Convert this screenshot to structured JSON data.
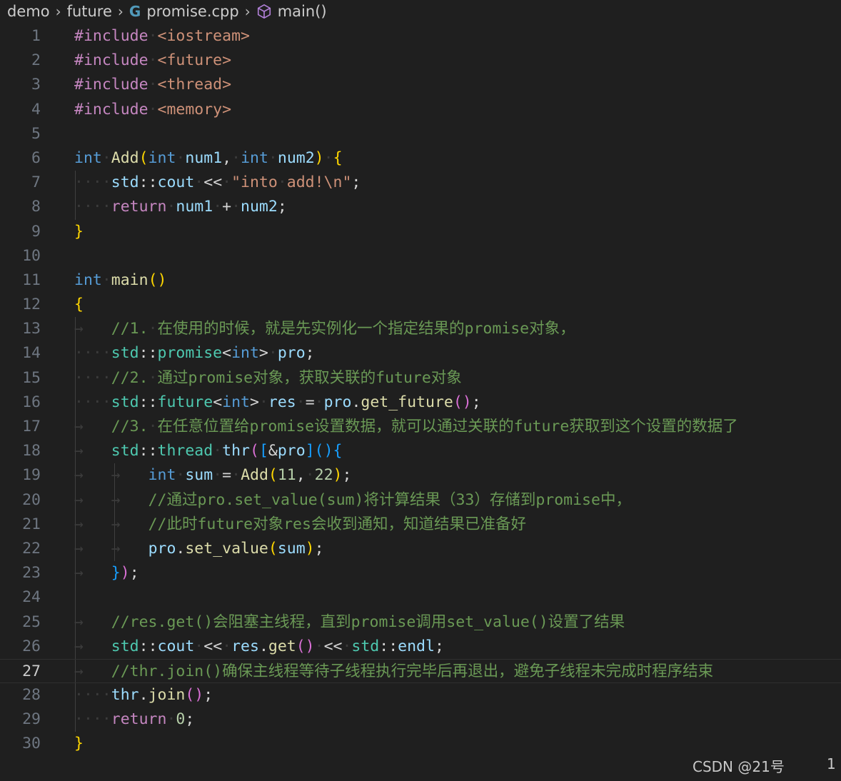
{
  "breadcrumb": {
    "items": [
      "demo",
      "future",
      "promise.cpp",
      "main()"
    ],
    "file_icon": "C++",
    "symbol_icon": "cube-icon"
  },
  "colors": {
    "background": "#1f1f1f",
    "keyword": "#569cd6",
    "function": "#dcdcaa",
    "type": "#4ec9b0",
    "string": "#ce9178",
    "comment": "#6a9955",
    "number": "#b5cea8",
    "variable": "#9cdcfe"
  },
  "editor": {
    "current_line": 27,
    "lines": [
      {
        "n": "1",
        "tokens": [
          [
            "pp",
            "#include"
          ],
          [
            "ws",
            "·"
          ],
          [
            "inc",
            "<iostream>"
          ]
        ]
      },
      {
        "n": "2",
        "tokens": [
          [
            "pp",
            "#include"
          ],
          [
            "ws",
            "·"
          ],
          [
            "inc",
            "<future>"
          ]
        ]
      },
      {
        "n": "3",
        "tokens": [
          [
            "pp",
            "#include"
          ],
          [
            "ws",
            "·"
          ],
          [
            "inc",
            "<thread>"
          ]
        ]
      },
      {
        "n": "4",
        "tokens": [
          [
            "pp",
            "#include"
          ],
          [
            "ws",
            "·"
          ],
          [
            "inc",
            "<memory>"
          ]
        ]
      },
      {
        "n": "5",
        "tokens": []
      },
      {
        "n": "6",
        "tokens": [
          [
            "kw",
            "int"
          ],
          [
            "ws",
            "·"
          ],
          [
            "fn",
            "Add"
          ],
          [
            "b1",
            "("
          ],
          [
            "kw",
            "int"
          ],
          [
            "ws",
            "·"
          ],
          [
            "var",
            "num1"
          ],
          [
            "op",
            ","
          ],
          [
            "ws",
            "·"
          ],
          [
            "kw",
            "int"
          ],
          [
            "ws",
            "·"
          ],
          [
            "var",
            "num2"
          ],
          [
            "b1",
            ")"
          ],
          [
            "ws",
            "·"
          ],
          [
            "b1",
            "{"
          ]
        ]
      },
      {
        "n": "7",
        "tokens": [
          [
            "ws",
            "····"
          ],
          [
            "var",
            "std"
          ],
          [
            "op",
            "::"
          ],
          [
            "var",
            "cout"
          ],
          [
            "ws",
            "·"
          ],
          [
            "op",
            "<<"
          ],
          [
            "ws",
            "·"
          ],
          [
            "str",
            "\"into"
          ],
          [
            "ws",
            "·"
          ],
          [
            "str",
            "add!\\n\""
          ],
          [
            "op",
            ";"
          ]
        ]
      },
      {
        "n": "8",
        "tokens": [
          [
            "ws",
            "····"
          ],
          [
            "ctrl",
            "return"
          ],
          [
            "ws",
            "·"
          ],
          [
            "var",
            "num1"
          ],
          [
            "ws",
            "·"
          ],
          [
            "op",
            "+"
          ],
          [
            "ws",
            "·"
          ],
          [
            "var",
            "num2"
          ],
          [
            "op",
            ";"
          ]
        ]
      },
      {
        "n": "9",
        "tokens": [
          [
            "b1",
            "}"
          ]
        ]
      },
      {
        "n": "10",
        "tokens": []
      },
      {
        "n": "11",
        "tokens": [
          [
            "kw",
            "int"
          ],
          [
            "ws",
            "·"
          ],
          [
            "fn",
            "main"
          ],
          [
            "b1",
            "()"
          ]
        ]
      },
      {
        "n": "12",
        "tokens": [
          [
            "b1",
            "{"
          ]
        ]
      },
      {
        "n": "13",
        "tokens": [
          [
            "ws",
            "→   "
          ],
          [
            "cmt",
            "//1."
          ],
          [
            "ws",
            "·"
          ],
          [
            "cmt",
            "在使用的时候，就是先实例化一个指定结果的promise对象，"
          ]
        ]
      },
      {
        "n": "14",
        "tokens": [
          [
            "ws",
            "····"
          ],
          [
            "type",
            "std"
          ],
          [
            "op",
            "::"
          ],
          [
            "type",
            "promise"
          ],
          [
            "op",
            "<"
          ],
          [
            "kw",
            "int"
          ],
          [
            "op",
            ">"
          ],
          [
            "ws",
            "·"
          ],
          [
            "var",
            "pro"
          ],
          [
            "op",
            ";"
          ]
        ]
      },
      {
        "n": "15",
        "tokens": [
          [
            "ws",
            "····"
          ],
          [
            "cmt",
            "//2."
          ],
          [
            "ws",
            "·"
          ],
          [
            "cmt",
            "通过promise对象，获取关联的future对象"
          ]
        ]
      },
      {
        "n": "16",
        "tokens": [
          [
            "ws",
            "····"
          ],
          [
            "type",
            "std"
          ],
          [
            "op",
            "::"
          ],
          [
            "type",
            "future"
          ],
          [
            "op",
            "<"
          ],
          [
            "kw",
            "int"
          ],
          [
            "op",
            ">"
          ],
          [
            "ws",
            "·"
          ],
          [
            "var",
            "res"
          ],
          [
            "ws",
            "·"
          ],
          [
            "op",
            "="
          ],
          [
            "ws",
            "·"
          ],
          [
            "var",
            "pro"
          ],
          [
            "op",
            "."
          ],
          [
            "fn",
            "get_future"
          ],
          [
            "b2",
            "()"
          ],
          [
            "op",
            ";"
          ]
        ]
      },
      {
        "n": "17",
        "tokens": [
          [
            "ws",
            "→   "
          ],
          [
            "cmt",
            "//3."
          ],
          [
            "ws",
            "·"
          ],
          [
            "cmt",
            "在任意位置给promise设置数据，就可以通过关联的future获取到这个设置的数据了"
          ]
        ]
      },
      {
        "n": "18",
        "tokens": [
          [
            "ws",
            "→   "
          ],
          [
            "type",
            "std"
          ],
          [
            "op",
            "::"
          ],
          [
            "type",
            "thread"
          ],
          [
            "ws",
            "·"
          ],
          [
            "var",
            "thr"
          ],
          [
            "b2",
            "("
          ],
          [
            "b3",
            "["
          ],
          [
            "op",
            "&"
          ],
          [
            "var",
            "pro"
          ],
          [
            "b3",
            "]"
          ],
          [
            "b3",
            "()"
          ],
          [
            "b3",
            "{"
          ]
        ]
      },
      {
        "n": "19",
        "tokens": [
          [
            "ws",
            "→   "
          ],
          [
            "ws",
            "→   "
          ],
          [
            "kw",
            "int"
          ],
          [
            "ws",
            "·"
          ],
          [
            "var",
            "sum"
          ],
          [
            "ws",
            "·"
          ],
          [
            "op",
            "="
          ],
          [
            "ws",
            "·"
          ],
          [
            "fn",
            "Add"
          ],
          [
            "b1",
            "("
          ],
          [
            "num",
            "11"
          ],
          [
            "op",
            ","
          ],
          [
            "ws",
            "·"
          ],
          [
            "num",
            "22"
          ],
          [
            "b1",
            ")"
          ],
          [
            "op",
            ";"
          ]
        ]
      },
      {
        "n": "20",
        "tokens": [
          [
            "ws",
            "→   "
          ],
          [
            "ws",
            "→   "
          ],
          [
            "cmt",
            "//通过pro.set_value(sum)将计算结果（33）存储到promise中，"
          ]
        ]
      },
      {
        "n": "21",
        "tokens": [
          [
            "ws",
            "→   "
          ],
          [
            "ws",
            "→   "
          ],
          [
            "cmt",
            "//此时future对象res会收到通知，知道结果已准备好"
          ]
        ]
      },
      {
        "n": "22",
        "tokens": [
          [
            "ws",
            "→   "
          ],
          [
            "ws",
            "→   "
          ],
          [
            "var",
            "pro"
          ],
          [
            "op",
            "."
          ],
          [
            "fn",
            "set_value"
          ],
          [
            "b1",
            "("
          ],
          [
            "var",
            "sum"
          ],
          [
            "b1",
            ")"
          ],
          [
            "op",
            ";"
          ]
        ]
      },
      {
        "n": "23",
        "tokens": [
          [
            "ws",
            "→   "
          ],
          [
            "b3",
            "}"
          ],
          [
            "b2",
            ")"
          ],
          [
            "op",
            ";"
          ]
        ]
      },
      {
        "n": "24",
        "tokens": []
      },
      {
        "n": "25",
        "tokens": [
          [
            "ws",
            "→   "
          ],
          [
            "cmt",
            "//res.get()会阻塞主线程，直到promise调用set_value()设置了结果"
          ]
        ]
      },
      {
        "n": "26",
        "tokens": [
          [
            "ws",
            "→   "
          ],
          [
            "type",
            "std"
          ],
          [
            "op",
            "::"
          ],
          [
            "var",
            "cout"
          ],
          [
            "ws",
            "·"
          ],
          [
            "op",
            "<<"
          ],
          [
            "ws",
            "·"
          ],
          [
            "var",
            "res"
          ],
          [
            "op",
            "."
          ],
          [
            "fn",
            "get"
          ],
          [
            "b2",
            "()"
          ],
          [
            "ws",
            "·"
          ],
          [
            "op",
            "<<"
          ],
          [
            "ws",
            "·"
          ],
          [
            "type",
            "std"
          ],
          [
            "op",
            "::"
          ],
          [
            "var",
            "endl"
          ],
          [
            "op",
            ";"
          ]
        ]
      },
      {
        "n": "27",
        "tokens": [
          [
            "ws",
            "→   "
          ],
          [
            "cmt",
            "//thr.join()确保主线程等待子线程执行完毕后再退出，避免子线程未完成时程序结束"
          ]
        ]
      },
      {
        "n": "28",
        "tokens": [
          [
            "ws",
            "····"
          ],
          [
            "var",
            "thr"
          ],
          [
            "op",
            "."
          ],
          [
            "fn",
            "join"
          ],
          [
            "b2",
            "()"
          ],
          [
            "op",
            ";"
          ]
        ]
      },
      {
        "n": "29",
        "tokens": [
          [
            "ws",
            "····"
          ],
          [
            "ctrl",
            "return"
          ],
          [
            "ws",
            "·"
          ],
          [
            "num",
            "0"
          ],
          [
            "op",
            ";"
          ]
        ]
      },
      {
        "n": "30",
        "tokens": [
          [
            "b1",
            "}"
          ]
        ]
      }
    ]
  },
  "watermark": "CSDN @21号",
  "corner_number": "1"
}
